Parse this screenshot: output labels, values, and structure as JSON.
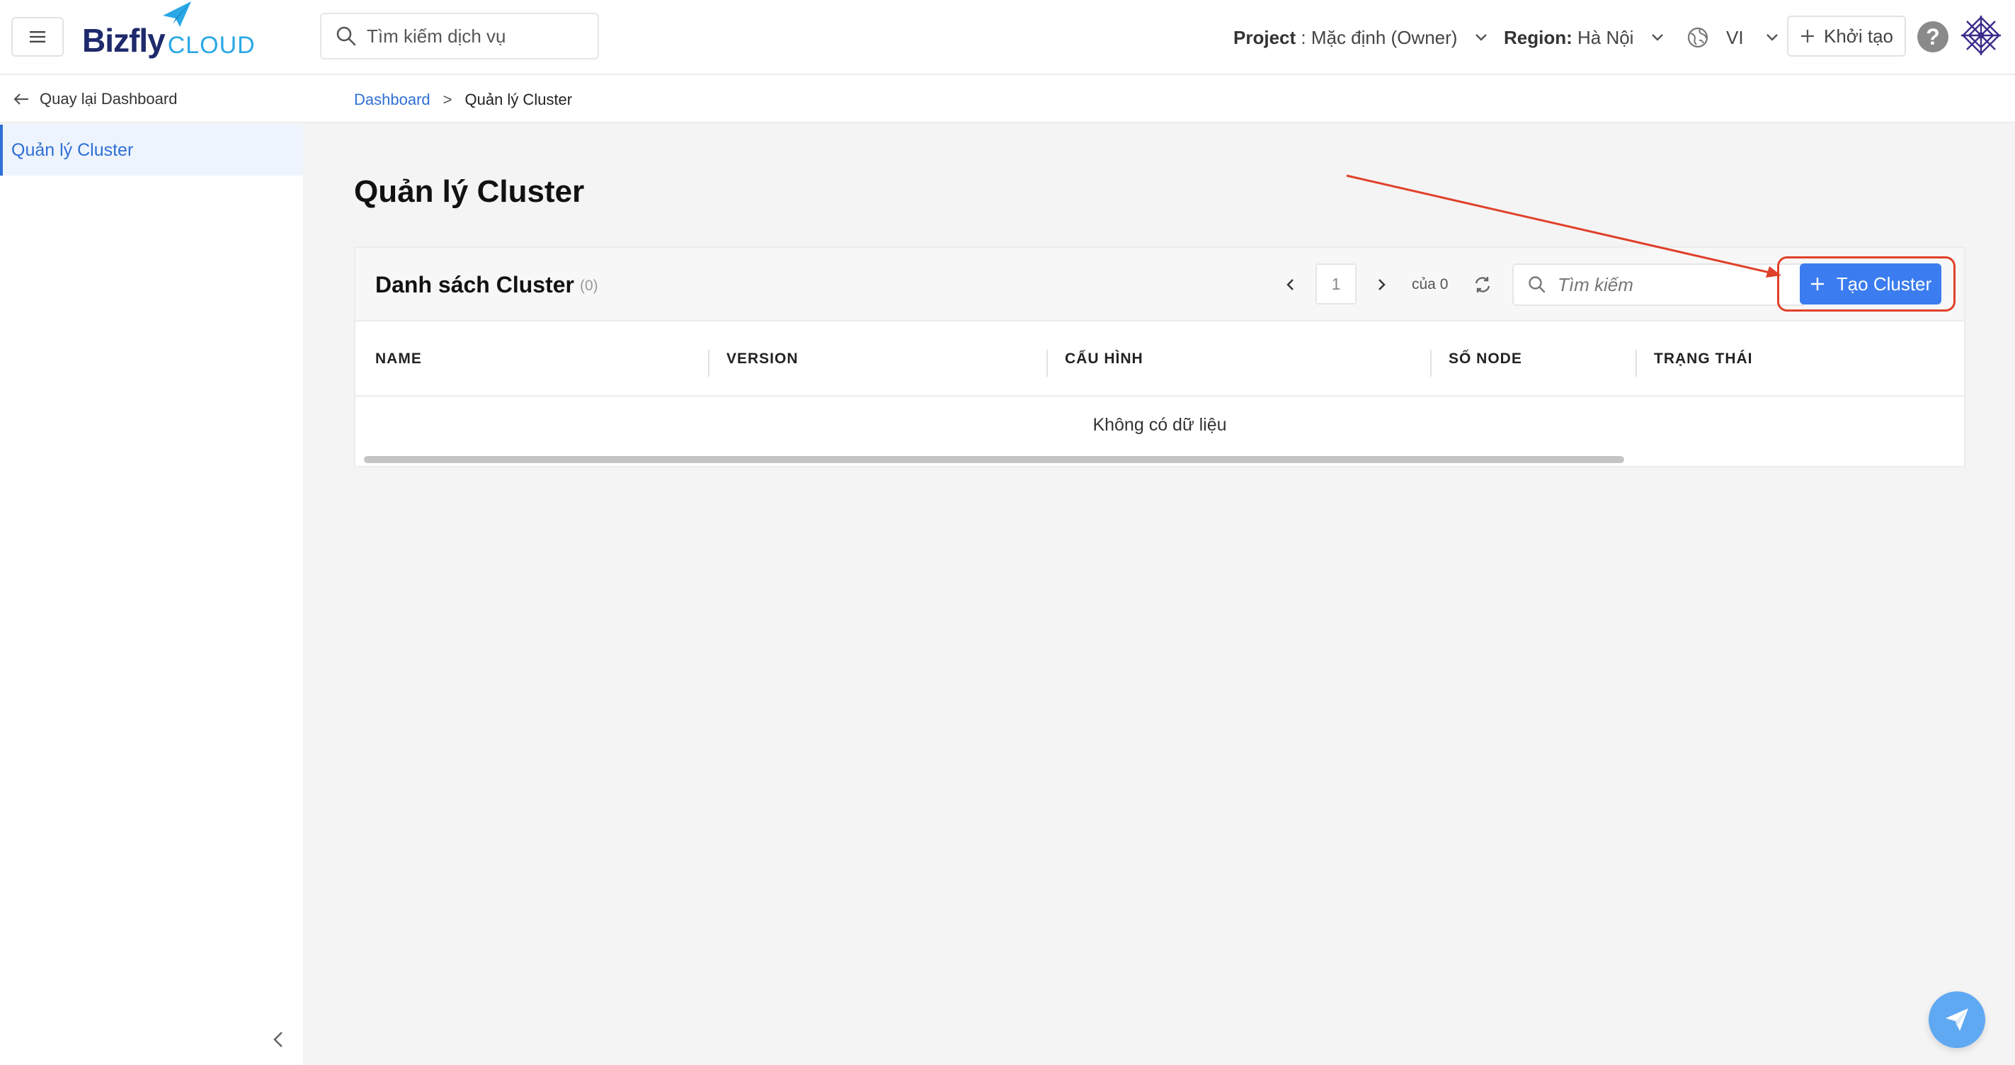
{
  "header": {
    "logo_main": "Bizfly",
    "logo_sub": "CLOUD",
    "search_placeholder": "Tìm kiếm dịch vụ",
    "project_label": "Project",
    "project_value": " : Mặc định (Owner)",
    "region_label": "Region:",
    "region_value": " Hà Nội",
    "language": "VI",
    "create_label": "Khởi tạo",
    "help_symbol": "?"
  },
  "subbar": {
    "back_label": "Quay lại Dashboard",
    "breadcrumb": {
      "home": "Dashboard",
      "separator": ">",
      "current": "Quản lý Cluster"
    }
  },
  "sidebar": {
    "items": [
      {
        "label": "Quản lý Cluster",
        "active": true
      }
    ]
  },
  "main": {
    "page_title": "Quản lý Cluster",
    "list": {
      "title": "Danh sách Cluster",
      "count": "(0)",
      "pager": {
        "page": "1",
        "of_label": "của 0"
      },
      "search_placeholder": "Tìm kiếm",
      "create_button": "Tạo Cluster",
      "columns": [
        "NAME",
        "VERSION",
        "CẤU HÌNH",
        "SỐ NODE",
        "TRẠNG THÁI"
      ],
      "empty_text": "Không có dữ liệu"
    }
  },
  "colors": {
    "primary": "#3b7cf0",
    "link": "#2f6fd6",
    "annotation": "#e0402a",
    "brand_dark": "#1e2a6b",
    "brand_light": "#2aa8e6"
  },
  "icons": {
    "menu": "hamburger-icon",
    "search": "search-icon",
    "chevron": "chevron-down-icon",
    "globe": "globe-icon",
    "plus": "plus-icon",
    "help": "help-icon",
    "back": "arrow-left-icon",
    "prev": "chevron-left-icon",
    "next": "chevron-right-icon",
    "refresh": "refresh-icon",
    "collapse": "chevron-left-icon",
    "chat": "paper-plane-icon"
  }
}
